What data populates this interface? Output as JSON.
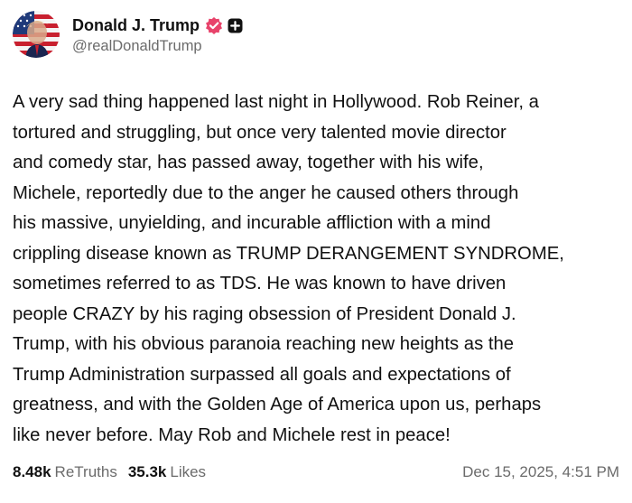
{
  "author": {
    "display_name": "Donald J. Trump",
    "handle": "@realDonaldTrump",
    "verified_badge_color": "#e8436b",
    "avatar_icon": "flag-portrait-avatar",
    "extra_badge_icon": "plus-square-icon"
  },
  "post": {
    "lines": [
      "A very sad thing happened last night in Hollywood. Rob Reiner, a",
      "tortured and struggling, but once very talented movie director",
      "and comedy star, has passed away, together with his wife,",
      "Michele, reportedly due to the anger he caused others through",
      "his massive, unyielding, and incurable affliction with a mind",
      "crippling disease known as TRUMP DERANGEMENT SYNDROME,",
      "sometimes referred to as TDS. He was known to have driven",
      "people CRAZY by his raging obsession of President Donald J.",
      "Trump, with his obvious paranoia reaching new heights as the",
      "Trump Administration surpassed all goals and expectations of",
      "greatness, and with the Golden Age of America upon us, perhaps",
      "like never before. May Rob and Michele rest in peace!"
    ]
  },
  "stats": {
    "retruths_count": "8.48k",
    "retruths_label": "ReTruths",
    "likes_count": "35.3k",
    "likes_label": "Likes"
  },
  "timestamp": "Dec 15, 2025, 4:51 PM",
  "colors": {
    "text": "#111111",
    "muted": "#6b6b6b",
    "background": "#ffffff"
  }
}
